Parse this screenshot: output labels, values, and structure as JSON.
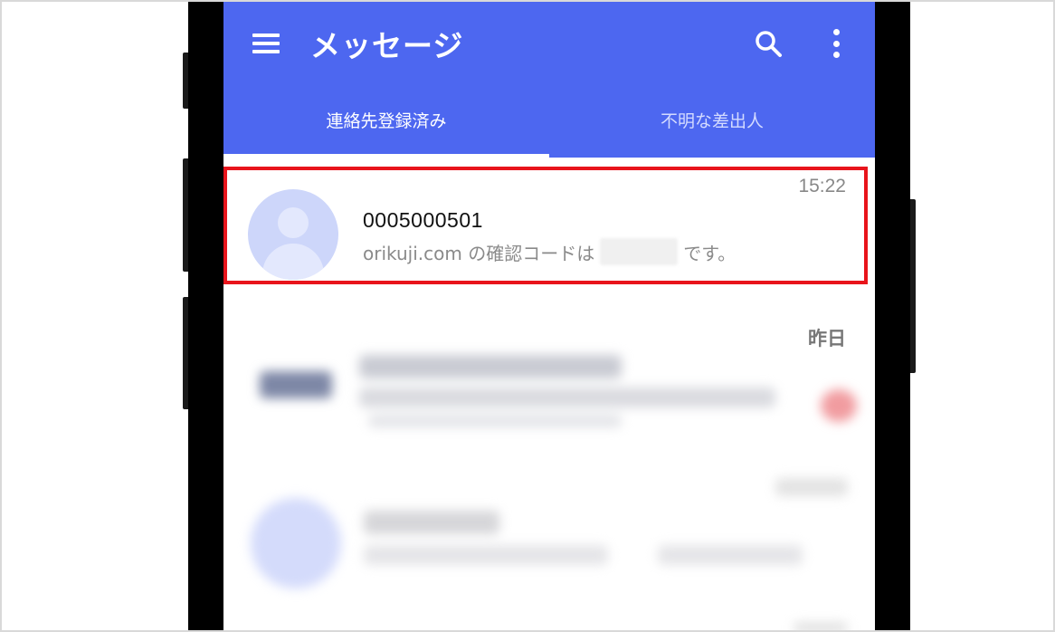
{
  "appbar": {
    "title": "メッセージ",
    "menu_icon": "menu-icon",
    "search_icon": "search-icon",
    "more_icon": "more-vert-icon",
    "color": "#4d67f0"
  },
  "tabs": [
    {
      "label": "連絡先登録済み",
      "active": true
    },
    {
      "label": "不明な差出人",
      "active": false
    }
  ],
  "messages": [
    {
      "sender": "0005000501",
      "time": "15:22",
      "preview_prefix": "orikuji.com の確認コードは",
      "preview_suffix": "です。",
      "highlighted": true
    }
  ],
  "date_label": "昨日",
  "highlight_color": "#e8141b"
}
